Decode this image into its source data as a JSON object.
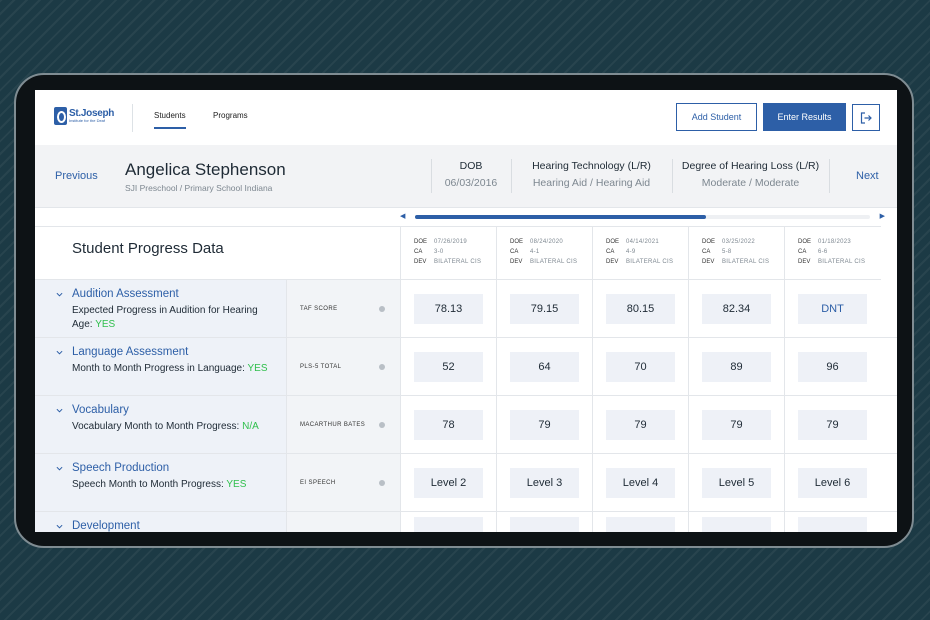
{
  "brand": {
    "name": "St.Joseph",
    "subtitle": "Institute for the Deaf"
  },
  "nav": {
    "students": "Students",
    "programs": "Programs"
  },
  "actions": {
    "add_student": "Add Student",
    "enter_results": "Enter Results"
  },
  "student": {
    "previous": "Previous",
    "next": "Next",
    "name": "Angelica Stephenson",
    "school": "SJI Preschool / Primary School Indiana",
    "dob_label": "DOB",
    "dob": "06/03/2016",
    "tech_label": "Hearing Technology (L/R)",
    "tech": "Hearing Aid / Hearing Aid",
    "loss_label": "Degree of Hearing Loss (L/R)",
    "loss": "Moderate / Moderate"
  },
  "scroll": {
    "left_icon": "◀",
    "right_icon": "▶",
    "position": 0.64
  },
  "table": {
    "title": "Student Progress Data",
    "keys": {
      "doe": "DOE",
      "ca": "CA",
      "dev": "DEV"
    },
    "columns": [
      {
        "doe": "07/26/2019",
        "ca": "3-0",
        "dev": "BILATERAL CIS"
      },
      {
        "doe": "08/24/2020",
        "ca": "4-1",
        "dev": "BILATERAL CIS"
      },
      {
        "doe": "04/14/2021",
        "ca": "4-9",
        "dev": "BILATERAL CIS"
      },
      {
        "doe": "03/25/2022",
        "ca": "5-8",
        "dev": "BILATERAL CIS"
      },
      {
        "doe": "01/18/2023",
        "ca": "6-6",
        "dev": "BILATERAL CIS"
      }
    ],
    "rows": [
      {
        "name": "Audition Assessment",
        "desc": "Expected Progress in Audition for Hearing Age:",
        "flag": "YES",
        "metric": "TAF SCORE",
        "values": [
          "78.13",
          "79.15",
          "80.15",
          "82.34",
          "DNT"
        ]
      },
      {
        "name": "Language Assessment",
        "desc": "Month to Month Progress in Language:",
        "flag": "YES",
        "metric": "PLS-5 TOTAL",
        "values": [
          "52",
          "64",
          "70",
          "89",
          "96"
        ]
      },
      {
        "name": "Vocabulary",
        "desc": "Vocabulary Month to Month Progress:",
        "flag": "N/A",
        "metric": "MACARTHUR BATES",
        "values": [
          "78",
          "79",
          "79",
          "79",
          "79"
        ]
      },
      {
        "name": "Speech Production",
        "desc": "Speech Month to Month Progress:",
        "flag": "YES",
        "metric": "EI SPEECH",
        "values": [
          "Level 2",
          "Level 3",
          "Level 4",
          "Level 5",
          "Level 6"
        ]
      },
      {
        "name": "Development",
        "desc": "",
        "flag": "",
        "metric": "",
        "values": [
          "",
          "",
          "",
          "",
          ""
        ]
      }
    ]
  },
  "colors": {
    "accent": "#2d5fa7",
    "yes": "#2fbf4c",
    "row_bg": "#eef2f8",
    "background": "#1c3a45"
  }
}
